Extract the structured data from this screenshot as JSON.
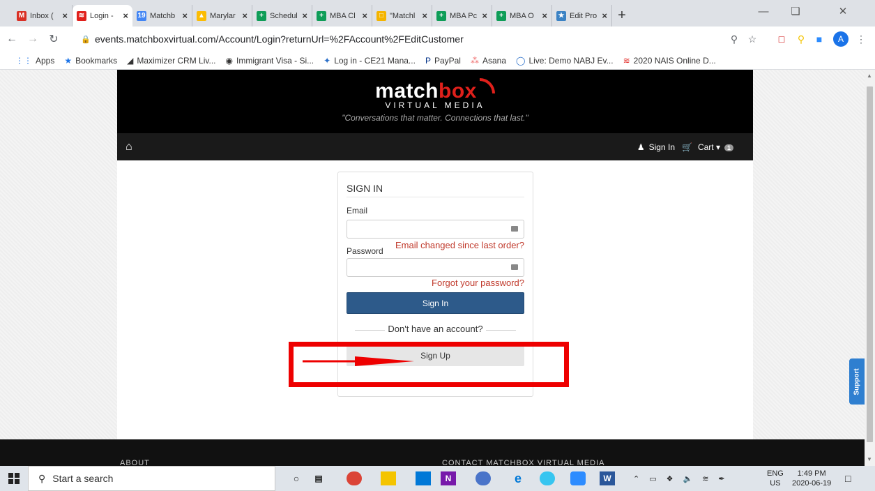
{
  "browser": {
    "tabs": [
      {
        "label": "Inbox (",
        "color": "#d93025",
        "glyph": "M"
      },
      {
        "label": "Login - ",
        "color": "#e0201b",
        "glyph": "≋",
        "active": true
      },
      {
        "label": "Matchb",
        "color": "#4285f4",
        "glyph": "19"
      },
      {
        "label": "Marylar",
        "color": "#fbbc04",
        "glyph": "▲"
      },
      {
        "label": "Schedul",
        "color": "#0f9d58",
        "glyph": "+"
      },
      {
        "label": "MBA Cl",
        "color": "#0f9d58",
        "glyph": "+"
      },
      {
        "label": "\"Matchl",
        "color": "#f4b400",
        "glyph": "□"
      },
      {
        "label": "MBA Pc",
        "color": "#0f9d58",
        "glyph": "+"
      },
      {
        "label": "MBA O",
        "color": "#0f9d58",
        "glyph": "+"
      },
      {
        "label": "Edit Pro",
        "color": "#3b82c4",
        "glyph": "★"
      }
    ],
    "url": "events.matchboxvirtual.com/Account/Login?returnUrl=%2FAccount%2FEditCustomer",
    "profile_initial": "A",
    "bookmarks": [
      {
        "label": "Apps",
        "icon": "apps-icon"
      },
      {
        "label": "Bookmarks",
        "icon": "star-icon"
      },
      {
        "label": "Maximizer CRM Liv...",
        "icon": "maximizer-icon"
      },
      {
        "label": "Immigrant Visa - Si...",
        "icon": "globe-icon"
      },
      {
        "label": "Log in - CE21 Mana...",
        "icon": "ce21-icon"
      },
      {
        "label": "PayPal",
        "icon": "paypal-icon"
      },
      {
        "label": "Asana",
        "icon": "asana-icon"
      },
      {
        "label": "Live: Demo NABJ Ev...",
        "icon": "live-icon"
      },
      {
        "label": "2020 NAIS Online D...",
        "icon": "matchbox-icon"
      }
    ]
  },
  "site": {
    "logo_main": "match",
    "logo_accent": "box",
    "logo_sub": "VIRTUAL MEDIA",
    "tagline": "\"Conversations that matter. Connections that last.\"",
    "nav": {
      "sign_in": "Sign In",
      "cart": "Cart",
      "cart_count": "1"
    }
  },
  "signin": {
    "title": "SIGN IN",
    "email_label": "Email",
    "email_value": "",
    "email_changed_link": "Email changed since last order?",
    "password_label": "Password",
    "password_value": "",
    "forgot_link": "Forgot your password?",
    "submit_label": "Sign In",
    "no_account": "Don't have an account?",
    "signup_label": "Sign Up"
  },
  "footer": {
    "left": "ABOUT",
    "right": "CONTACT MATCHBOX VIRTUAL MEDIA"
  },
  "support_label": "Support",
  "taskbar": {
    "search_placeholder": "Start a search",
    "lang": "ENG",
    "region": "US",
    "time": "1:49 PM",
    "date": "2020-06-19"
  },
  "colors": {
    "primary_button": "#2d5a8a",
    "brand_red": "#e0201b",
    "annotation": "#ee0000"
  }
}
